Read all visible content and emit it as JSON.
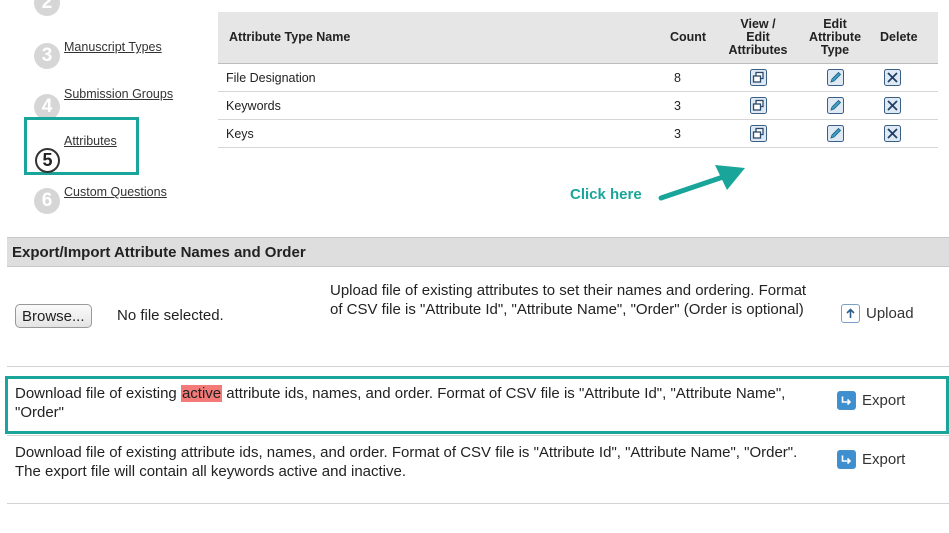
{
  "steps": [
    {
      "number": "2",
      "label": ""
    },
    {
      "number": "3",
      "label": "Manuscript Types"
    },
    {
      "number": "4",
      "label": "Submission Groups"
    },
    {
      "number": "5",
      "label": "Attributes"
    },
    {
      "number": "6",
      "label": "Custom Questions"
    }
  ],
  "attributes_table": {
    "headers": {
      "name": "Attribute Type Name",
      "count": "Count",
      "view_1": "View /",
      "view_2": "Edit",
      "view_3": "Attributes",
      "edit_1": "Edit",
      "edit_2": "Attribute",
      "edit_3": "Type",
      "delete": "Delete"
    },
    "rows": [
      {
        "name": "File Designation",
        "count": "8"
      },
      {
        "name": "Keywords",
        "count": "3"
      },
      {
        "name": "Keys",
        "count": "3"
      }
    ]
  },
  "callout": {
    "text": "Click here",
    "color": "#1aa59a"
  },
  "export_import": {
    "title": "Export/Import Attribute Names and Order",
    "browse_label": "Browse...",
    "no_file_text": "No file selected.",
    "upload_desc": "Upload file of existing attributes to set their names and ordering. Format of CSV file is \"Attribute Id\", \"Attribute Name\", \"Order\" (Order is optional)",
    "upload_label": "Upload",
    "active_desc_before": "Download file of existing ",
    "active_highlight": "active",
    "active_desc_after": " attribute ids, names, and order. Format of CSV file is \"Attribute Id\", \"Attribute Name\", \"Order\"",
    "export_label_1": "Export",
    "all_desc": "Download file of existing attribute ids, names, and order. Format of CSV file is \"Attribute Id\", \"Attribute Name\", \"Order\". The export file will contain all keywords active and inactive.",
    "export_label_2": "Export"
  },
  "icons": [
    "view-edit-attributes-icon",
    "edit-pencil-icon",
    "delete-x-icon",
    "upload-arrow-icon",
    "export-arrow-icon"
  ],
  "colors": {
    "accent": "#1aa59a",
    "highlight": "#f47a7a",
    "header_bg": "#e6e6e6"
  }
}
